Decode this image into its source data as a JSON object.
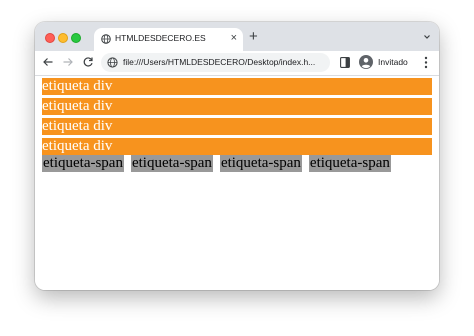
{
  "browser": {
    "tab": {
      "title": "HTMLDESDECERO.ES",
      "favicon": "globe-icon",
      "close_glyph": "×"
    },
    "new_tab_glyph": "+",
    "toolbar": {
      "url": "file:///Users/HTMLDESDECERO/Desktop/index.h...",
      "profile_label": "Invitado"
    }
  },
  "page": {
    "divs": [
      {
        "label": "etiqueta div"
      },
      {
        "label": "etiqueta div"
      },
      {
        "label": "etiqueta div"
      },
      {
        "label": "etiqueta div"
      }
    ],
    "spans": [
      {
        "label": "etiqueta-span"
      },
      {
        "label": "etiqueta-span"
      },
      {
        "label": "etiqueta-span"
      },
      {
        "label": "etiqueta-span"
      }
    ]
  },
  "colors": {
    "div_background": "#f7931e",
    "span_background": "#999999",
    "tabstrip": "#dee1e6"
  }
}
